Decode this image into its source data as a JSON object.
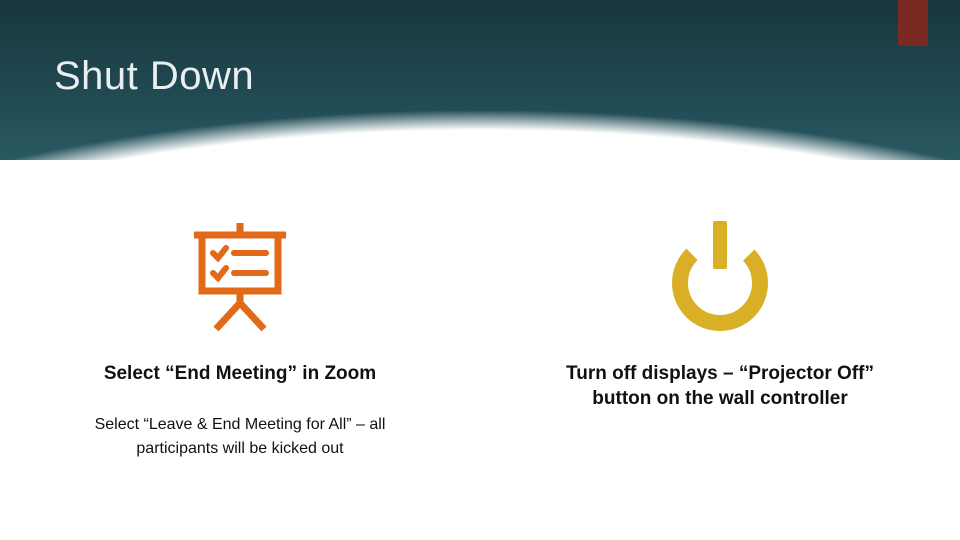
{
  "title": "Shut Down",
  "colors": {
    "accent_bar": "#7a2a23",
    "icon_presentation": "#e06a1a",
    "icon_power": "#d9af25",
    "header_gradient_top": "#17363d",
    "header_gradient_bottom": "#2a5962"
  },
  "columns": [
    {
      "icon": "presentation-icon",
      "heading": "Select “End Meeting” in Zoom",
      "sub": "Select “Leave & End Meeting for All” – all participants will be kicked out"
    },
    {
      "icon": "power-icon",
      "heading": "Turn off displays – “Projector Off” button on the wall controller",
      "sub": ""
    }
  ]
}
